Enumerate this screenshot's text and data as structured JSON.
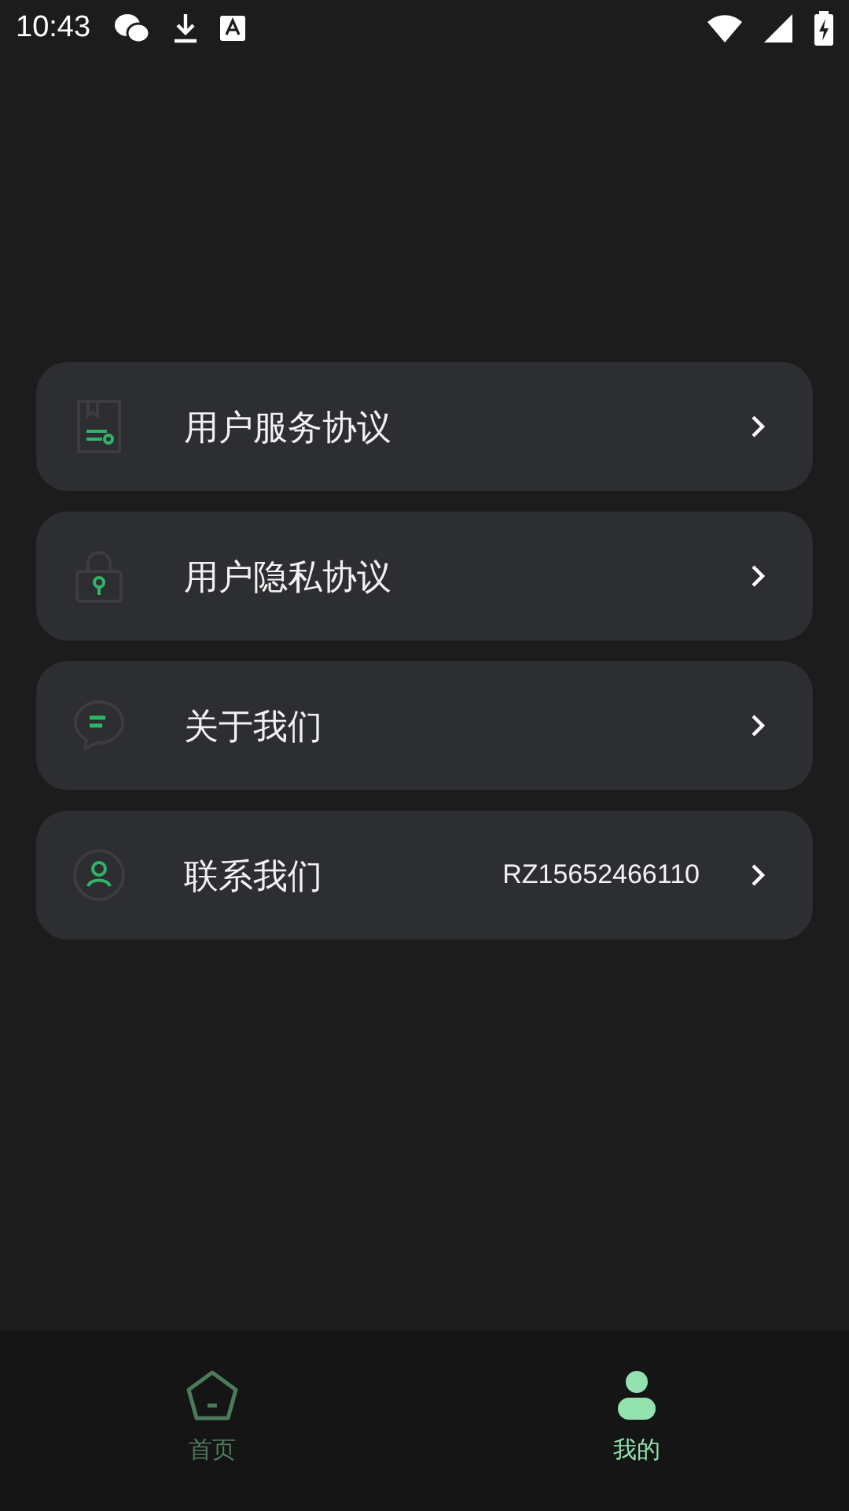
{
  "status_bar": {
    "time": "10:43"
  },
  "menu": [
    {
      "kind": "document",
      "label": "用户服务协议"
    },
    {
      "kind": "lock",
      "label": "用户隐私协议"
    },
    {
      "kind": "chat",
      "label": "关于我们"
    },
    {
      "kind": "person",
      "label": "联系我们",
      "value": "RZ15652466110"
    }
  ],
  "bottom_nav": [
    {
      "kind": "home",
      "label": "首页",
      "selected": false
    },
    {
      "kind": "profile",
      "label": "我的",
      "selected": true
    }
  ]
}
